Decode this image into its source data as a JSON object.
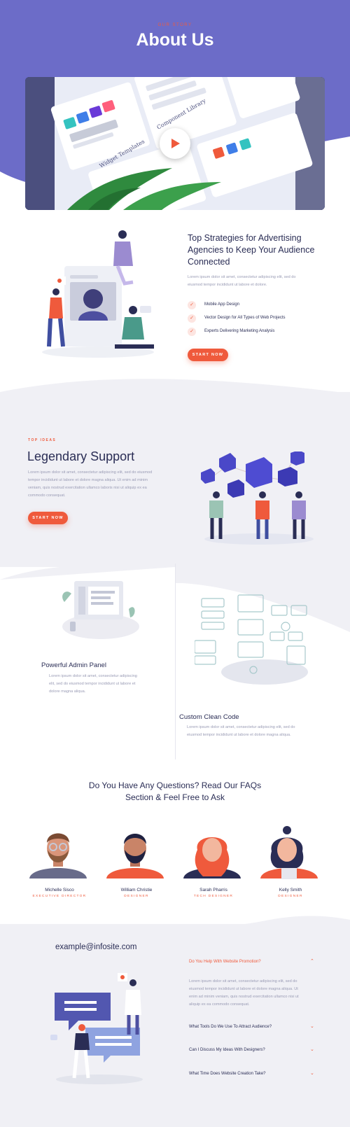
{
  "hero": {
    "kicker": "OUR STORY",
    "title": "About Us"
  },
  "video": {
    "play_label": "Play video",
    "card_labels": [
      "Widget Templates",
      "Component Library"
    ]
  },
  "strategies": {
    "heading": "Top Strategies for Advertising Agencies to Keep Your Audience Connected",
    "heading_lines": [
      "Top Strategies for Advertising",
      "Agencies to Keep Your Audience",
      "Connected"
    ],
    "body_lines": [
      "Lorem ipsum dolor sit amet, consectetur adipiscing elit, sed do",
      "eiusmod tempor incididunt ut labore et dolore."
    ],
    "checklist": [
      "Mobile App Design",
      "Vector Design for All Types of Web Projects",
      "Experts Delivering Marketing Analysis"
    ],
    "button": "START NOW"
  },
  "support": {
    "kicker": "TOP IDEAS",
    "title": "Legendary Support",
    "body_lines": [
      "Lorem ipsum dolor sit amet, consectetur adipiscing elit, sed do eiusmod",
      "tempor incididunt ut labore et dolore magna aliqua. Ut enim ad minim",
      "veniam, quis nostrud exercitation ullamco laboris nisi ut aliquip ex ea",
      "commodo consequat."
    ],
    "button": "START NOW"
  },
  "features": [
    {
      "title": "Powerful Admin Panel",
      "body_lines": [
        "Lorem ipsum dolor sit amet, consectetur adipiscing",
        "elit, sed do eiusmod tempor incididunt ut labore et",
        "dolore magna aliqua."
      ]
    },
    {
      "title": "Custom Clean Code",
      "body_lines": [
        "Lorem ipsum dolor sit amet, consectetur adipiscing elit, sed do",
        "eiusmod tempor incididunt ut labore et dolore magna aliqua."
      ]
    }
  ],
  "faq_heading_lines": [
    "Do You Have Any Questions? Read Our FAQs",
    "Section & Feel Free to Ask"
  ],
  "team": [
    {
      "name": "Michelle Sisco",
      "role": "EXECUTIVE DIRECTOR"
    },
    {
      "name": "William Christie",
      "role": "DESIGNER"
    },
    {
      "name": "Sarah Pharris",
      "role": "TECH DESIGNER"
    },
    {
      "name": "Kelly Smith",
      "role": "DESIGNER"
    }
  ],
  "contact": {
    "email": "example@infosite.com"
  },
  "faq": [
    {
      "question": "Do You Help With Website Promotion?",
      "open": true,
      "answer_lines": [
        "Lorem ipsum dolor sit amet, consectetur adipiscing elit, sed do",
        "eiusmod tempor incididunt ut labore et dolore magna aliqua. Ut",
        "enim ad minim veniam, quis nostrud exercitation ullamco nisi ut",
        "aliquip ex ea commodo consequat."
      ]
    },
    {
      "question": "What Tools Do We Use To Attract Audience?",
      "open": false
    },
    {
      "question": "Can I Discuss My Ideas With Designers?",
      "open": false
    },
    {
      "question": "What Time Does Website Creation Take?",
      "open": false
    }
  ],
  "colors": {
    "hero": "#6c6cc8",
    "accent": "#ef5a3c",
    "navy": "#2a2d55",
    "muted": "#9a9cb5",
    "section_bg": "#f0f0f5"
  }
}
